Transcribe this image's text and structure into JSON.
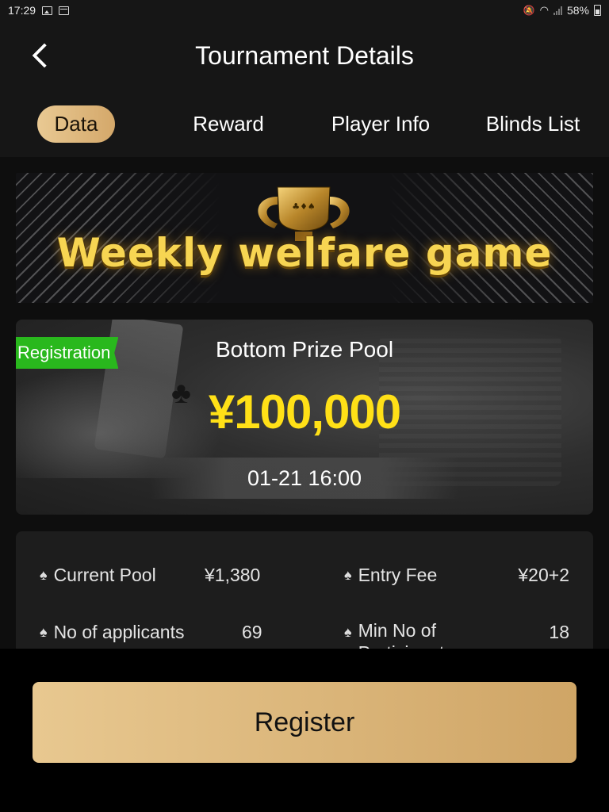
{
  "status_bar": {
    "time": "17:29",
    "battery": "58%",
    "battery_level": 0.58
  },
  "header": {
    "title": "Tournament Details"
  },
  "tabs": [
    {
      "label": "Data",
      "active": true
    },
    {
      "label": "Reward",
      "active": false
    },
    {
      "label": "Player Info",
      "active": false
    },
    {
      "label": "Blinds List",
      "active": false
    }
  ],
  "banner": {
    "title": "Weekly welfare game"
  },
  "prize": {
    "badge": "Registration",
    "label": "Bottom Prize Pool",
    "amount": "¥100,000",
    "time": "01-21 16:00"
  },
  "info": {
    "current_pool_label": "Current Pool",
    "current_pool_value": "¥1,380",
    "entry_fee_label": "Entry Fee",
    "entry_fee_value": "¥20+2",
    "applicants_label": "No of applicants",
    "applicants_value": "69",
    "min_participants_label": "Min No of Participants",
    "min_participants_value": "18"
  },
  "footer": {
    "register_label": "Register"
  },
  "colors": {
    "accent_gold": "#d4a86a",
    "prize_yellow": "#ffe017",
    "badge_green": "#29b81d"
  }
}
